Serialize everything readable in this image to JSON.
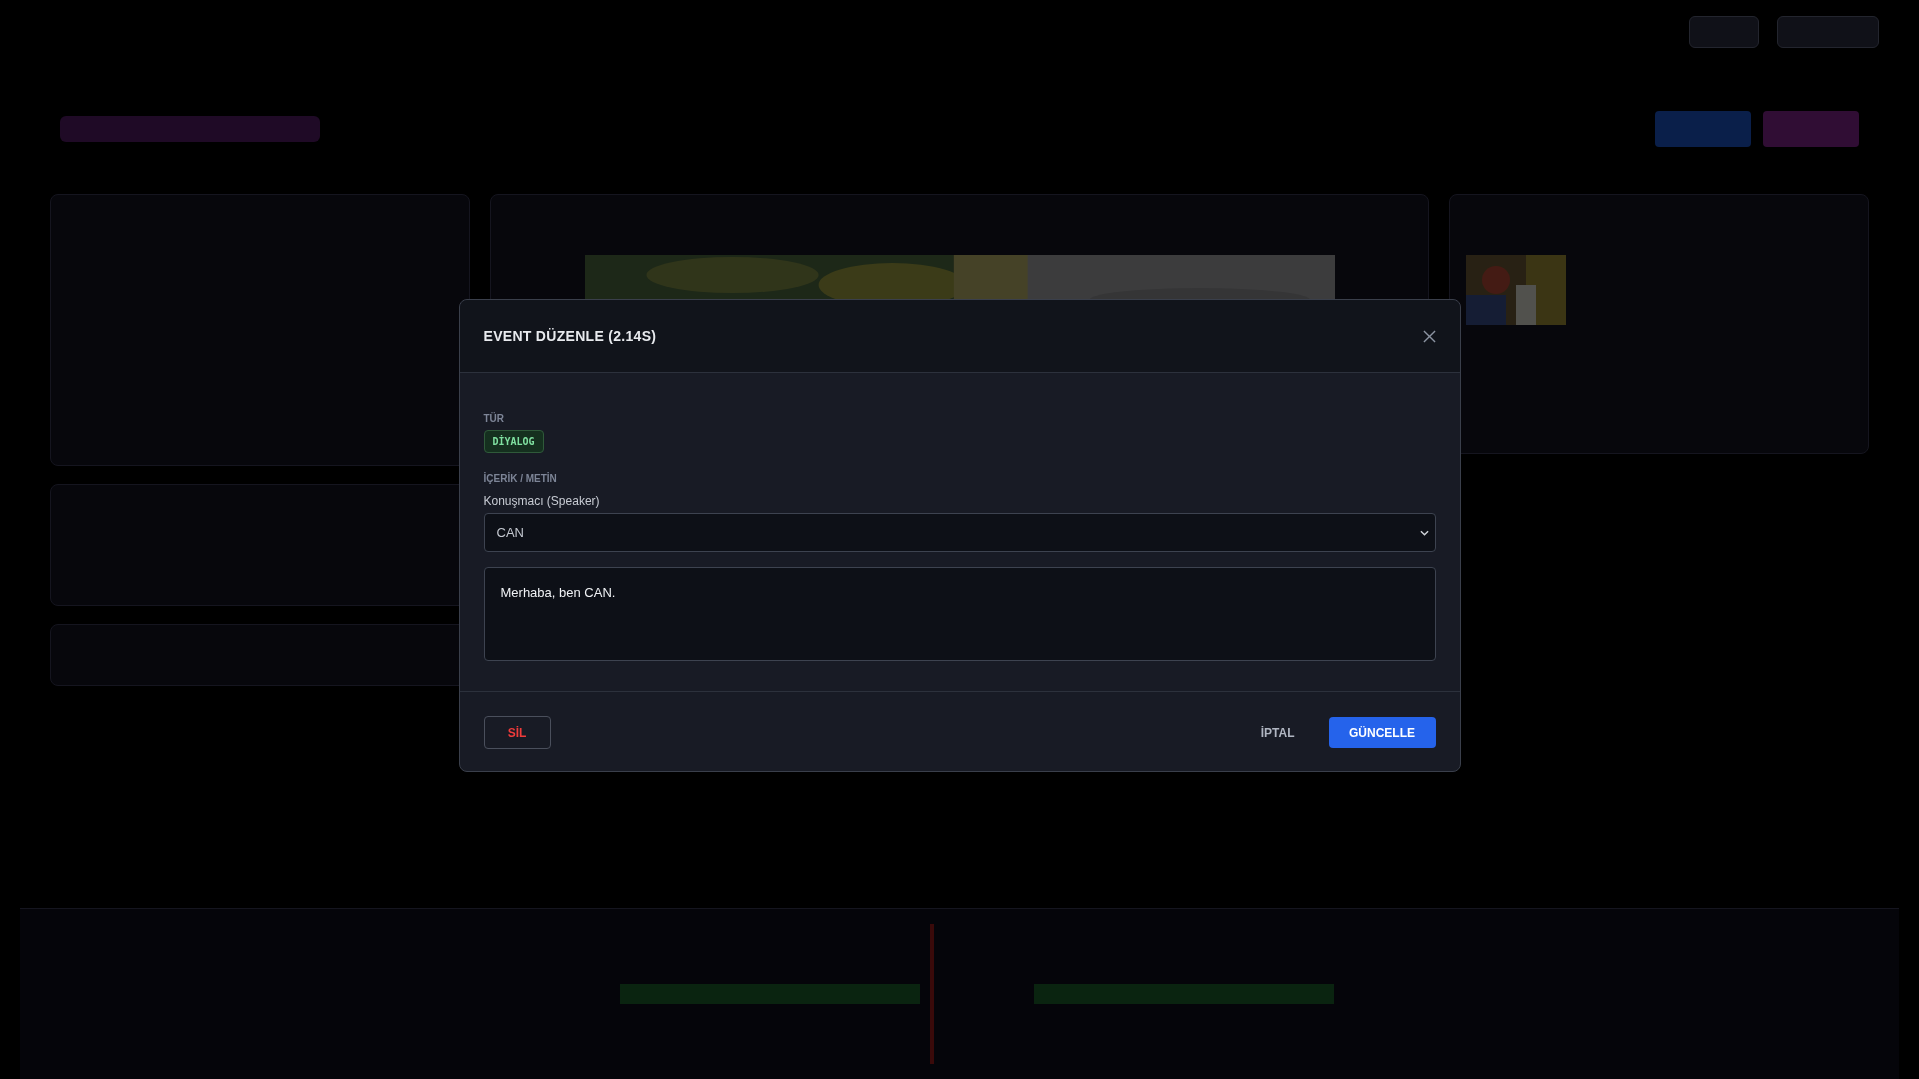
{
  "modal": {
    "title": "EVENT DÜZENLE (2.14S)",
    "type_label": "TÜR",
    "type_badge": "DİYALOG",
    "content_label": "İÇERİK / METİN",
    "speaker": {
      "label": "Konuşmacı (Speaker)",
      "value": "CAN"
    },
    "text": {
      "value": "Merhaba, ben CAN."
    },
    "buttons": [
      {
        "label": "SİL",
        "kind": "danger"
      },
      {
        "label": "İPTAL",
        "kind": "ghost"
      },
      {
        "label": "GÜNCELLE",
        "kind": "primary"
      }
    ]
  }
}
